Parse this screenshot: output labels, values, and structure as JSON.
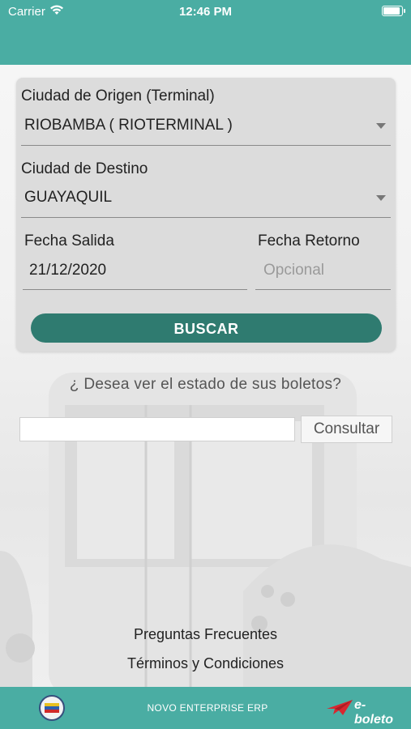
{
  "status_bar": {
    "carrier": "Carrier",
    "time": "12:46 PM"
  },
  "form": {
    "origin_label": "Ciudad de Origen (Terminal)",
    "origin_value": "RIOBAMBA ( RIOTERMINAL )",
    "destination_label": "Ciudad de Destino",
    "destination_value": "GUAYAQUIL",
    "departure_label": "Fecha Salida",
    "departure_value": "21/12/2020",
    "return_label": "Fecha Retorno",
    "return_placeholder": "Opcional",
    "search_button": "BUSCAR"
  },
  "ticket_status": {
    "question": "¿ Desea ver el estado de sus boletos?",
    "input_value": "",
    "consult_button": "Consultar"
  },
  "links": {
    "faq": "Preguntas Frecuentes",
    "terms": "Términos y Condiciones"
  },
  "footer": {
    "company": "NOVO ENTERPRISE ERP",
    "brand": "e-boleto"
  },
  "colors": {
    "header": "#4aada3",
    "button": "#2f7b70"
  }
}
